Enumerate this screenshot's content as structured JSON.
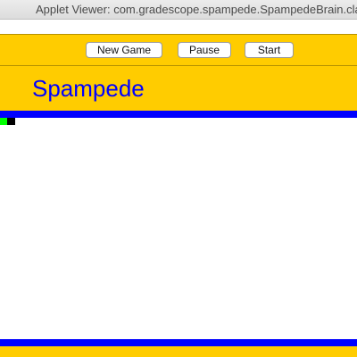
{
  "window": {
    "title": "Applet Viewer: com.gradescope.spampede.SpampedeBrain.class"
  },
  "toolbar": {
    "new_game_label": "New Game",
    "pause_label": "Pause",
    "start_label": "Start"
  },
  "header": {
    "title": "Spampede"
  },
  "colors": {
    "toolbar_bg": "#ffcc00",
    "title_text": "#0000ff",
    "board_border": "#0000ff",
    "board_bg": "#ffffff",
    "snake_body": "#00ff00",
    "snake_head": "#000000"
  }
}
